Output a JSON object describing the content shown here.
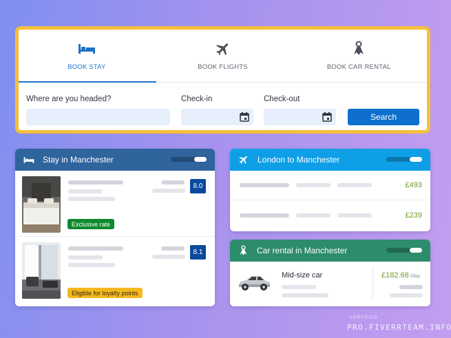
{
  "search": {
    "tabs": [
      {
        "label": "BOOK STAY",
        "icon": "bed-icon",
        "active": true
      },
      {
        "label": "BOOK FLIGHTS",
        "icon": "plane-icon",
        "active": false
      },
      {
        "label": "BOOK CAR RENTAL",
        "icon": "car-key-icon",
        "active": false
      }
    ],
    "destination_label": "Where are you headed?",
    "destination_value": "",
    "checkin_label": "Check-in",
    "checkout_label": "Check-out",
    "search_label": "Search"
  },
  "stay_card": {
    "title": "Stay in Manchester",
    "icon": "bed-icon",
    "hotels": [
      {
        "score": "8.0",
        "badge": "Exclusive rate"
      },
      {
        "score": "8.1",
        "badge": "Eligible for loyalty points"
      }
    ]
  },
  "flight_card": {
    "title": "London to Manchester",
    "icon": "plane-icon",
    "prices": [
      "£493",
      "£239"
    ]
  },
  "car_card": {
    "title": "Car rental in Manchester",
    "icon": "car-key-icon",
    "car_name": "Mid-size car",
    "price": "£182.68",
    "per": "/day"
  },
  "watermark": {
    "top": "CERTIFIED",
    "main": "PRO.FIVERRTEAM.INFO"
  },
  "colors": {
    "accent_blue": "#0e6fcd",
    "highlight_border": "#f5be3c",
    "stay_header": "#2f649d",
    "flight_header": "#0f9fe6",
    "car_header": "#2d8c6c",
    "price_green": "#6f9a2a"
  }
}
